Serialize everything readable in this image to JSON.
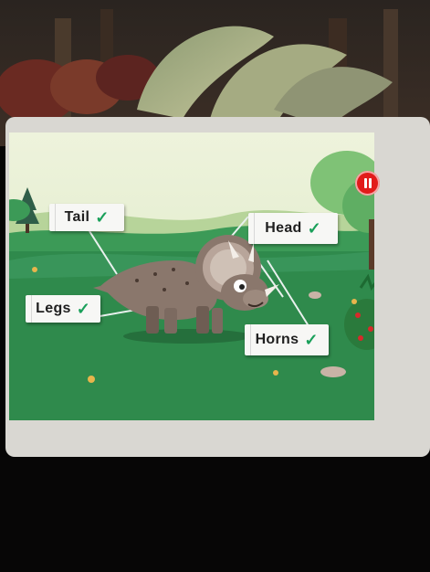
{
  "game": {
    "labels": [
      {
        "id": "tail",
        "text": "Tail",
        "status_icon": "check-icon"
      },
      {
        "id": "head",
        "text": "Head",
        "status_icon": "check-icon"
      },
      {
        "id": "legs",
        "text": "Legs",
        "status_icon": "check-icon"
      },
      {
        "id": "horns",
        "text": "Horns",
        "status_icon": "check-icon"
      }
    ],
    "check_glyph": "✓",
    "pause_icon": "pause-icon",
    "colors": {
      "accent_red": "#e21b1b",
      "check_green": "#1aa05a",
      "grass": "#2f8a4c",
      "dino": "#8a776c"
    }
  }
}
